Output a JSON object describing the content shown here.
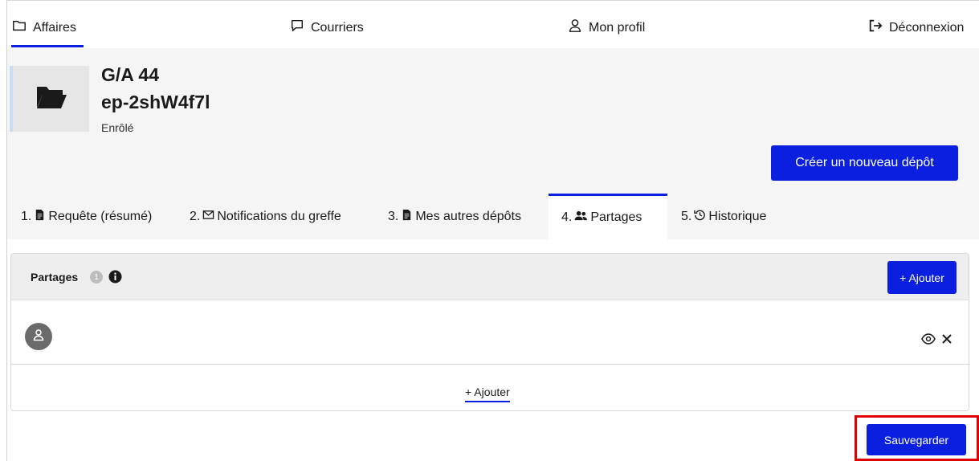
{
  "nav": {
    "affaires": "Affaires",
    "courriers": "Courriers",
    "profil": "Mon profil",
    "deconnexion": "Déconnexion"
  },
  "case": {
    "title": "G/A 44",
    "reference": "ep-2shW4f7l",
    "status": "Enrôlé",
    "new_deposit_label": "Créer un nouveau dépôt"
  },
  "tabs": [
    {
      "number": "1.",
      "label": "Requête (résumé)",
      "icon": "document-icon"
    },
    {
      "number": "2.",
      "label": "Notifications du greffe",
      "icon": "mail-icon"
    },
    {
      "number": "3.",
      "label": "Mes autres dépôts",
      "icon": "document-icon"
    },
    {
      "number": "4.",
      "label": "Partages",
      "icon": "users-icon",
      "active": true
    },
    {
      "number": "5.",
      "label": "Historique",
      "icon": "history-icon"
    }
  ],
  "partages": {
    "title": "Partages",
    "count": "1",
    "add_header_label": "+ Ajouter",
    "add_link_label": "+ Ajouter"
  },
  "save_label": "Sauvegarder",
  "colors": {
    "primary": "#0b1fe0",
    "highlight": "#e00000"
  }
}
